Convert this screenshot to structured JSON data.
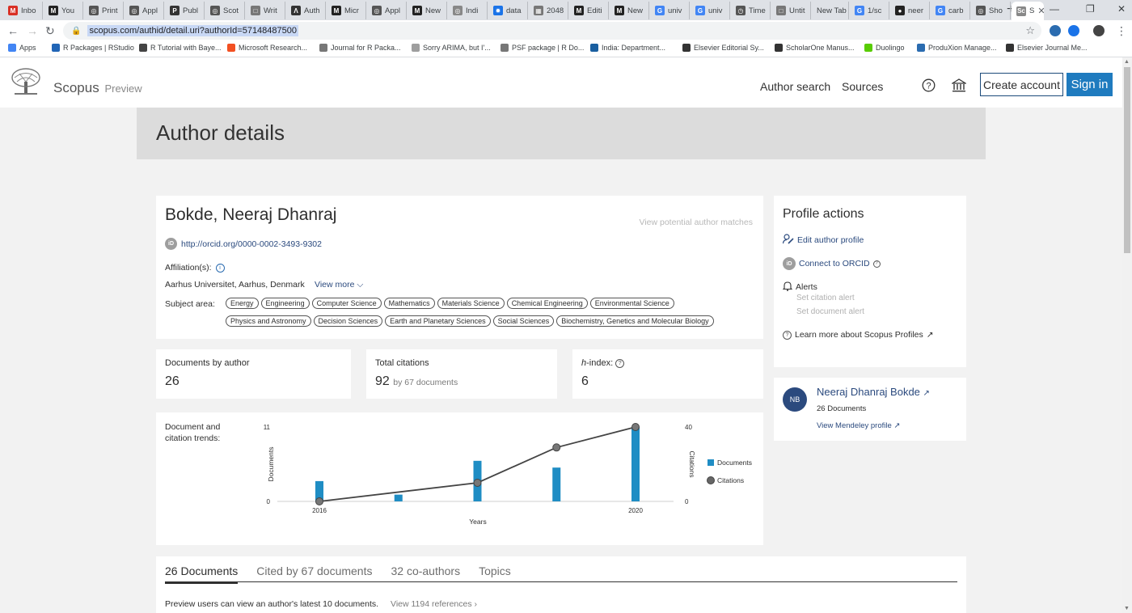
{
  "browser": {
    "tabs": [
      {
        "label": "Inbo",
        "favicon": "gmail-icon",
        "color": "#d93025",
        "glyph": "M"
      },
      {
        "label": "You",
        "favicon": "medium-icon",
        "color": "#222222",
        "glyph": "M"
      },
      {
        "label": "Print",
        "favicon": "globe-icon",
        "color": "#555555",
        "glyph": "◎"
      },
      {
        "label": "Appl",
        "favicon": "globe-icon",
        "color": "#555555",
        "glyph": "◎"
      },
      {
        "label": "Publ",
        "favicon": "p-icon",
        "color": "#333333",
        "glyph": "P"
      },
      {
        "label": "Scot",
        "favicon": "globe-icon",
        "color": "#555555",
        "glyph": "◎"
      },
      {
        "label": "Writ",
        "favicon": "doc-icon",
        "color": "#777777",
        "glyph": "□"
      },
      {
        "label": "Auth",
        "favicon": "a-icon",
        "color": "#333333",
        "glyph": "Λ"
      },
      {
        "label": "Micr",
        "favicon": "medium-icon",
        "color": "#222222",
        "glyph": "M"
      },
      {
        "label": "Appl",
        "favicon": "globe-icon",
        "color": "#555555",
        "glyph": "◎"
      },
      {
        "label": "New",
        "favicon": "medium-icon",
        "color": "#222222",
        "glyph": "M"
      },
      {
        "label": "Indi",
        "favicon": "globe-icon",
        "color": "#888888",
        "glyph": "◎"
      },
      {
        "label": "data",
        "favicon": "gear-icon",
        "color": "#1a73e8",
        "glyph": "✹"
      },
      {
        "label": "2048",
        "favicon": "grid-icon",
        "color": "#777777",
        "glyph": "▦"
      },
      {
        "label": "Editi",
        "favicon": "medium-icon",
        "color": "#222222",
        "glyph": "M"
      },
      {
        "label": "New",
        "favicon": "medium-icon",
        "color": "#222222",
        "glyph": "M"
      },
      {
        "label": "univ",
        "favicon": "google-icon",
        "color": "#4285f4",
        "glyph": "G"
      },
      {
        "label": "univ",
        "favicon": "google-icon",
        "color": "#4285f4",
        "glyph": "G"
      },
      {
        "label": "Time",
        "favicon": "clock-icon",
        "color": "#555555",
        "glyph": "◷"
      },
      {
        "label": "Untit",
        "favicon": "doc-icon",
        "color": "#777777",
        "glyph": "□"
      },
      {
        "label": "New Tab",
        "favicon": "",
        "color": "#dee1e6",
        "glyph": ""
      },
      {
        "label": "1/sc",
        "favicon": "google-icon",
        "color": "#4285f4",
        "glyph": "G"
      },
      {
        "label": "neer",
        "favicon": "github-icon",
        "color": "#222222",
        "glyph": "●"
      },
      {
        "label": "carb",
        "favicon": "google-icon",
        "color": "#4285f4",
        "glyph": "G"
      },
      {
        "label": "Sho",
        "favicon": "globe-icon",
        "color": "#555555",
        "glyph": "◎"
      },
      {
        "label": "S",
        "favicon": "scopus-icon",
        "color": "#888888",
        "glyph": "Sc",
        "active": true
      }
    ],
    "url": "scopus.com/authid/detail.uri?authorId=57148487500",
    "bookmarks": [
      {
        "label": "Apps",
        "icon": "apps-icon",
        "color": "#4285f4"
      },
      {
        "label": "R Packages | RStudio",
        "icon": "r-icon",
        "color": "#2165b6"
      },
      {
        "label": "R Tutorial with Baye...",
        "icon": "r-icon",
        "color": "#444444"
      },
      {
        "label": "Microsoft Research...",
        "icon": "microsoft-icon",
        "color": "#f25022"
      },
      {
        "label": "Journal for R Packa...",
        "icon": "doc-icon",
        "color": "#777777"
      },
      {
        "label": "Sorry ARIMA, but I'...",
        "icon": "globe-icon",
        "color": "#9e9e9e"
      },
      {
        "label": "PSF package | R Do...",
        "icon": "doc-icon",
        "color": "#777777"
      },
      {
        "label": "India: Department...",
        "icon": "dp-icon",
        "color": "#1a5fa0"
      },
      {
        "label": "Elsevier Editorial Sy...",
        "icon": "globe-icon",
        "color": "#333333"
      },
      {
        "label": "ScholarOne Manus...",
        "icon": "scholarone-icon",
        "color": "#333333"
      },
      {
        "label": "Duolingo",
        "icon": "duolingo-icon",
        "color": "#58cc02"
      },
      {
        "label": "ProduXion Manage...",
        "icon": "produxion-icon",
        "color": "#2b6cb0"
      },
      {
        "label": "Elsevier Journal Me...",
        "icon": "globe-icon",
        "color": "#333333"
      }
    ]
  },
  "header": {
    "brand": "Scopus",
    "brand_suffix": "Preview",
    "nav": [
      "Author search",
      "Sources"
    ],
    "create_account": "Create account",
    "sign_in": "Sign in"
  },
  "page_title": "Author details",
  "author": {
    "name": "Bokde, Neeraj Dhanraj",
    "view_matches": "View potential author matches",
    "orcid_url": "http://orcid.org/0000-0002-3493-9302",
    "affiliation_label": "Affiliation(s):",
    "affiliation": "Aarhus Universitet, Aarhus, Denmark",
    "view_more": "View more",
    "subject_label": "Subject area:",
    "subjects": [
      "Energy",
      "Engineering",
      "Computer Science",
      "Mathematics",
      "Materials Science",
      "Chemical Engineering",
      "Environmental Science",
      "Physics and Astronomy",
      "Decision Sciences",
      "Earth and Planetary Sciences",
      "Social Sciences",
      "Biochemistry, Genetics and Molecular Biology"
    ]
  },
  "metrics": {
    "documents_label": "Documents by author",
    "documents_value": "26",
    "citations_label": "Total citations",
    "citations_value": "92",
    "citations_sub": "by 67 documents",
    "hindex_label": "-index:",
    "hindex_prefix": "h",
    "hindex_value": "6"
  },
  "trends_label": "Document and citation trends:",
  "chart_data": {
    "type": "bar",
    "x": [
      2016,
      2017,
      2018,
      2019,
      2020
    ],
    "series": [
      {
        "name": "Documents",
        "kind": "bar",
        "axis": "left",
        "color": "#1f8dc4",
        "values": [
          3,
          1,
          6,
          5,
          11
        ]
      },
      {
        "name": "Citations",
        "kind": "line",
        "axis": "right",
        "color": "#555555",
        "values": [
          0,
          0,
          0,
          0,
          0
        ],
        "points": [
          [
            2016,
            0
          ],
          [
            2018,
            10
          ],
          [
            2019,
            29
          ],
          [
            2020,
            40
          ]
        ]
      }
    ],
    "xlabel": "Years",
    "ylabel": "Documents",
    "y2label": "Citations",
    "ylim": [
      0,
      11
    ],
    "y2lim": [
      0,
      40
    ],
    "xticks": [
      "2016",
      "2020"
    ],
    "yticks": [
      "0",
      "11"
    ],
    "y2ticks": [
      "0",
      "40"
    ],
    "legend": "right"
  },
  "profile_actions": {
    "title": "Profile actions",
    "edit": "Edit author profile",
    "orcid": "Connect to ORCID",
    "alerts": "Alerts",
    "citation_alert": "Set citation alert",
    "document_alert": "Set document alert",
    "learn": "Learn more about Scopus Profiles"
  },
  "mendeley": {
    "initials": "NB",
    "name": "Neeraj Dhanraj Bokde",
    "docs": "26 Documents",
    "link": "View Mendeley profile"
  },
  "doc_tabs": [
    "26 Documents",
    "Cited by 67 documents",
    "32 co-authors",
    "Topics"
  ],
  "preview_note": "Preview users can view an author's latest 10 documents.",
  "view_refs": "View 1194 references"
}
